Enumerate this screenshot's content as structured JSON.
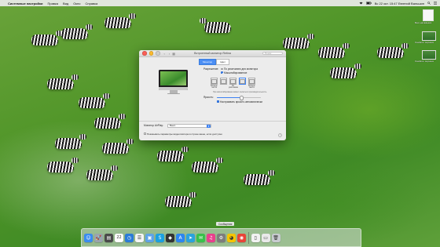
{
  "menubar": {
    "apple_glyph": "",
    "app_name": "Системные настройки",
    "items": [
      "Правка",
      "Вид",
      "Окно",
      "Справка"
    ],
    "status_right": "Вс 22 окт. 15:47  Евгений Вальшин",
    "wifi_icon": "wifi-icon",
    "battery_icon": "battery-icon"
  },
  "desktop": {
    "items": [
      {
        "label": "Без названия"
      },
      {
        "label": "Снимок экрана"
      },
      {
        "label": "Снимок экрана"
      }
    ]
  },
  "window": {
    "title": "Встроенный монитор Retina",
    "search_placeholder": "Поиск",
    "nav_back": "‹",
    "nav_forward": "›",
    "grid_glyph": "▦",
    "tabs": [
      {
        "label": "Монитор",
        "active": true
      },
      {
        "label": "Цвет",
        "active": false
      }
    ],
    "resolution": {
      "label": "Разрешение:",
      "options": [
        {
          "label": "По умолчанию для монитора",
          "selected": false
        },
        {
          "label": "Масштабированное",
          "selected": true
        }
      ],
      "sizes": [
        {
          "label": "Больше текста",
          "selected": false
        },
        {
          "label": "",
          "selected": false
        },
        {
          "label": "По умолчанию",
          "selected": false
        },
        {
          "label": "",
          "selected": true
        },
        {
          "label": "Больше места",
          "selected": false
        }
      ],
      "note": "При масштабировании может снизиться производительность."
    },
    "brightness": {
      "label": "Яркость:",
      "value": 0.55,
      "auto_label": "Настраивать яркость автоматически",
      "auto_checked": true
    },
    "airplay": {
      "label": "Монитор AirPlay:",
      "value": "Выкл."
    },
    "mirror_checkbox": {
      "label": "Показывать параметры видеоповтора в строке меню, если доступно",
      "checked": false
    },
    "help": "?"
  },
  "dock": {
    "tooltip": "Сообщения",
    "apps": [
      {
        "name": "finder-icon",
        "glyph": "☺",
        "color": "#3a8cf0"
      },
      {
        "name": "launchpad-icon",
        "glyph": "🚀",
        "color": "#9aa4ad"
      },
      {
        "name": "notes-icon",
        "glyph": "▤",
        "color": "#4a4a4a"
      },
      {
        "name": "calendar-icon",
        "glyph": "22",
        "color": "#ffffff"
      },
      {
        "name": "clock-icon",
        "glyph": "◷",
        "color": "#2a7bd8"
      },
      {
        "name": "reminders-icon",
        "glyph": "☰",
        "color": "#f5f5f5"
      },
      {
        "name": "preview-icon",
        "glyph": "▣",
        "color": "#5fa3e8"
      },
      {
        "name": "skype-icon",
        "glyph": "S",
        "color": "#1ba0e1"
      },
      {
        "name": "app-icon",
        "glyph": "◆",
        "color": "#333333"
      },
      {
        "name": "appstore-icon",
        "glyph": "A",
        "color": "#2d86f0"
      },
      {
        "name": "telegram-icon",
        "glyph": "➤",
        "color": "#2aa3de"
      },
      {
        "name": "messages-icon",
        "glyph": "✉",
        "color": "#38c14a"
      },
      {
        "name": "itunes-icon",
        "glyph": "♫",
        "color": "#e93f8c"
      },
      {
        "name": "settings-icon",
        "glyph": "⚙",
        "color": "#7d7d7d"
      },
      {
        "name": "cyberduck-icon",
        "glyph": "◕",
        "color": "#f5c400"
      },
      {
        "name": "chrome-icon",
        "glyph": "◉",
        "color": "#e84438"
      },
      {
        "name": "document-icon",
        "glyph": "▯",
        "color": "#f2f2f2"
      },
      {
        "name": "downloads-icon",
        "glyph": "▭",
        "color": "#e9e9e9"
      },
      {
        "name": "trash-icon",
        "glyph": "🗑",
        "color": "#c8ccd0"
      }
    ]
  },
  "colors": {
    "accent": "#3d82f2",
    "window_bg": "#ececec",
    "grass": "#4f9528"
  }
}
